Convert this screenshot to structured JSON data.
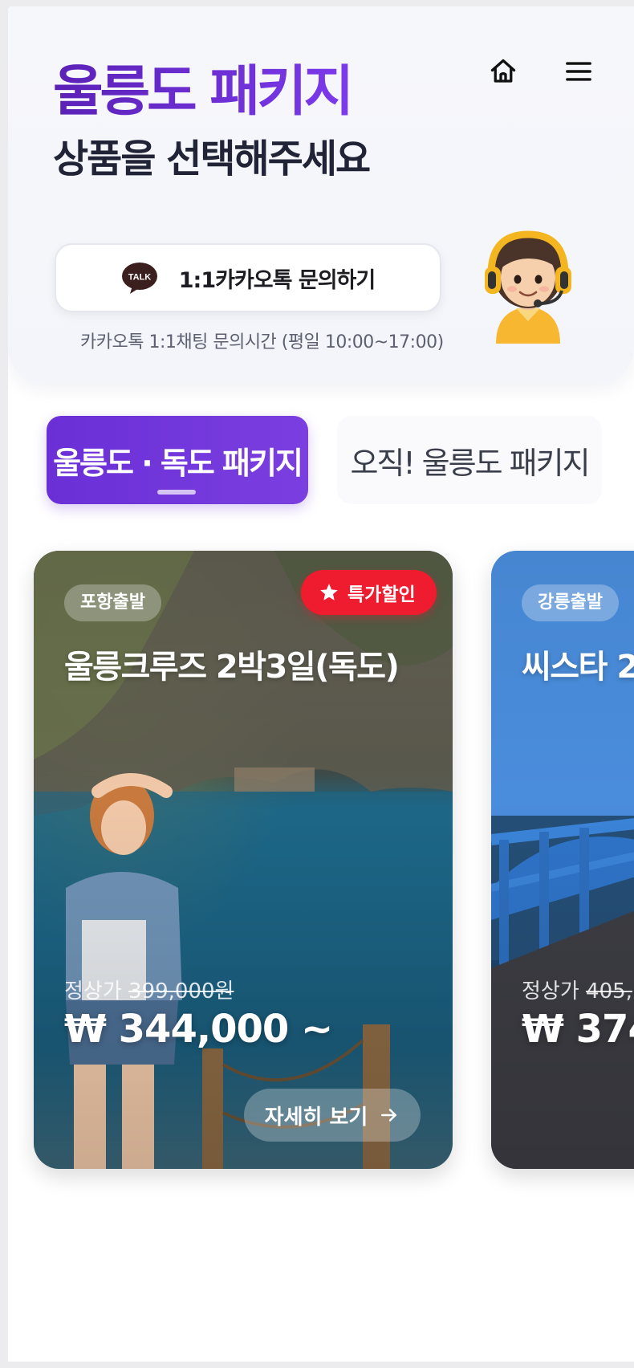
{
  "header": {
    "brand_title": "울릉도 패키지",
    "subtitle": "상품을 선택해주세요",
    "home_icon": "home-icon",
    "menu_icon": "hamburger-menu-icon",
    "accent_color": "#6a2fd6"
  },
  "kakao": {
    "button_label": "1:1카카오톡 문의하기",
    "icon_text": "TALK",
    "hours": "카카오톡 1:1채팅 문의시간 (평일 10:00~17:00)"
  },
  "tabs": [
    {
      "label": "울릉도 · 독도 패키지",
      "active": true
    },
    {
      "label": "오직! 울릉도 패키지",
      "active": false
    }
  ],
  "cards": [
    {
      "departure": "포항출발",
      "badge": "특가할인",
      "title": "울릉크루즈 2박3일(독도)",
      "orig_label": "정상가",
      "orig_price": "399,000원",
      "price": "₩ 344,000 ~",
      "detail_label": "자세히 보기"
    },
    {
      "departure": "강릉출발",
      "title": "씨스타 2",
      "orig_label": "정상가",
      "orig_price": "405,",
      "price": "₩ 374,"
    }
  ],
  "colors": {
    "sale_badge": "#ef1b2e"
  }
}
